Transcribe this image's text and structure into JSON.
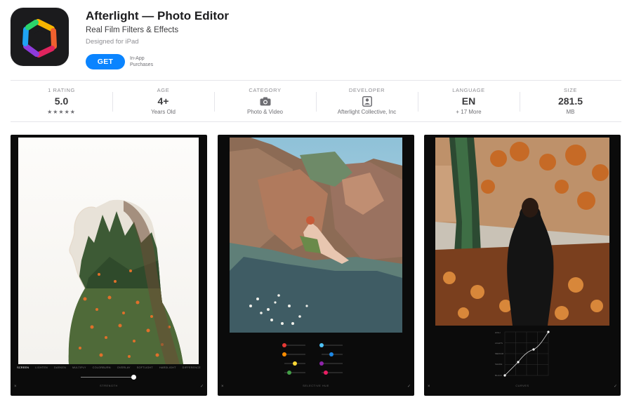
{
  "app": {
    "title": "Afterlight — Photo Editor",
    "subtitle": "Real Film Filters & Effects",
    "designed_for": "Designed for iPad",
    "get_label": "GET",
    "iap_line1": "In-App",
    "iap_line2": "Purchases"
  },
  "info": {
    "ratings": {
      "label": "1 RATING",
      "value": "5.0",
      "stars": "★★★★★",
      "rating_value": 5
    },
    "age": {
      "label": "AGE",
      "value": "4+",
      "sub": "Years Old"
    },
    "category": {
      "label": "CATEGORY",
      "icon": "camera-icon",
      "sub": "Photo & Video"
    },
    "developer": {
      "label": "DEVELOPER",
      "icon": "person-icon",
      "sub": "Afterlight Collective, Inc"
    },
    "language": {
      "label": "LANGUAGE",
      "value": "EN",
      "sub": "+ 17 More"
    },
    "size": {
      "label": "SIZE",
      "value": "281.5",
      "sub": "MB"
    }
  },
  "screenshots": {
    "shot1": {
      "tools": [
        "SCREEN",
        "LIGHTEN",
        "DARKEN",
        "MULTIPLY",
        "COLORBURN",
        "OVERLAY",
        "SOFTLIGHT",
        "HARDLIGHT",
        "DIFFERENCE"
      ],
      "active_tool": "SCREEN",
      "slider_value": 0.95,
      "caption": "STRENGTH",
      "cancel": "×",
      "confirm": "✓"
    },
    "shot2": {
      "caption": "SELECTIVE HUE",
      "cancel": "×",
      "confirm": "✓",
      "swatch_colors": [
        "#e53935",
        "#fb8c00",
        "#fdd835",
        "#43a047",
        "#4fc3f7",
        "#1e88e5",
        "#8e24aa",
        "#e91e63"
      ]
    },
    "shot3": {
      "caption": "CURVES",
      "curve_labels": [
        "HIGH",
        "LIGHTS",
        "MEDIUM",
        "SHADE",
        "BLACK"
      ],
      "cancel": "×",
      "confirm": "✓"
    }
  },
  "colors": {
    "accent": "#0a84ff",
    "icon_background": "#1b1b1d"
  }
}
